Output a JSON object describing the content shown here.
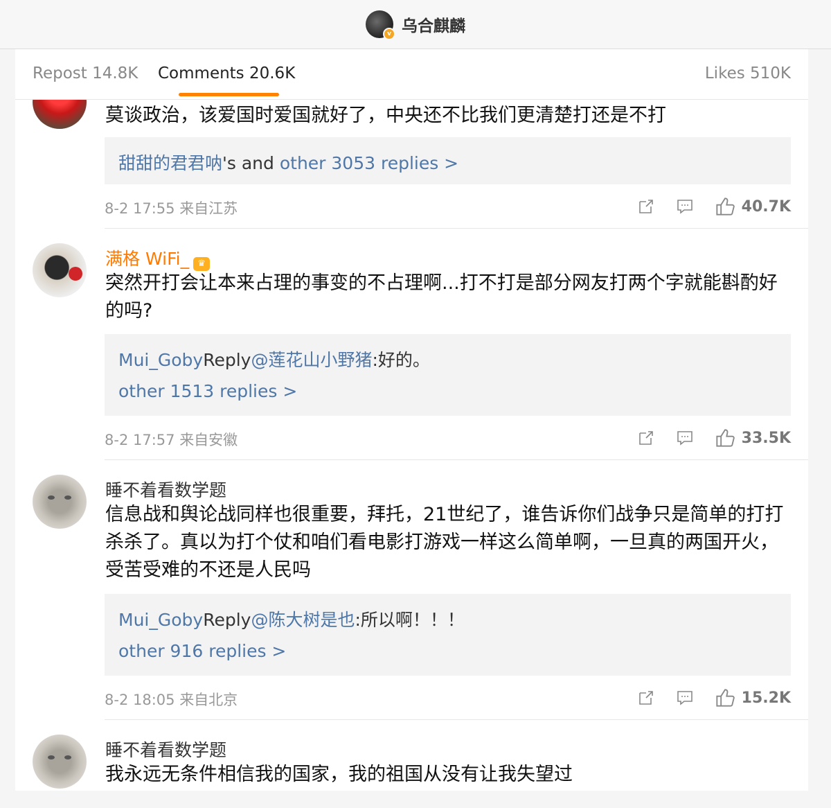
{
  "header": {
    "account_name": "乌合麒麟",
    "verified_badge": "v"
  },
  "tabs": [
    {
      "label": "Repost 14.8K"
    },
    {
      "label": "Comments 20.6K"
    },
    {
      "label": "Likes 510K"
    }
  ],
  "comments": [
    {
      "text": "莫谈政治，该爱国时爱国就好了，中央还不比我们更清楚打还是不打",
      "replies": {
        "user": "甜甜的君君呐",
        "suffix": "'s and ",
        "more": "other 3053 replies >"
      },
      "date": "8-2 17:55",
      "location": "来自江苏",
      "likes": "40.7K"
    },
    {
      "user": "满格 WiFi_",
      "text": "突然开打会让本来占理的事变的不占理啊...打不打是部分网友打两个字就能斟酌好的吗?",
      "reply": {
        "user": "Mui_Goby",
        "word": "Reply",
        "mention": "@莲花山小野猪",
        "text": ":好的。"
      },
      "more": "other 1513 replies >",
      "date": "8-2 17:57",
      "location": "来自安徽",
      "likes": "33.5K"
    },
    {
      "user": "睡不着看数学题",
      "text": "信息战和舆论战同样也很重要，拜托，21世纪了，谁告诉你们战争只是简单的打打杀杀了。真以为打个仗和咱们看电影打游戏一样这么简单啊，一旦真的两国开火，受苦受难的不还是人民吗",
      "reply": {
        "user": "Mui_Goby",
        "word": "Reply",
        "mention": "@陈大树是也",
        "text": ":所以啊！！！"
      },
      "more": "other 916 replies >",
      "date": "8-2 18:05",
      "location": "来自北京",
      "likes": "15.2K"
    },
    {
      "user": "睡不着看数学题",
      "text": "我永远无条件相信我的国家，我的祖国从没有让我失望过"
    }
  ],
  "colors": {
    "accent": "#ff8200",
    "link": "#4e77a8",
    "username_highlight": "#ff7a00"
  },
  "icons": [
    "share-icon",
    "comment-icon",
    "like-icon"
  ]
}
